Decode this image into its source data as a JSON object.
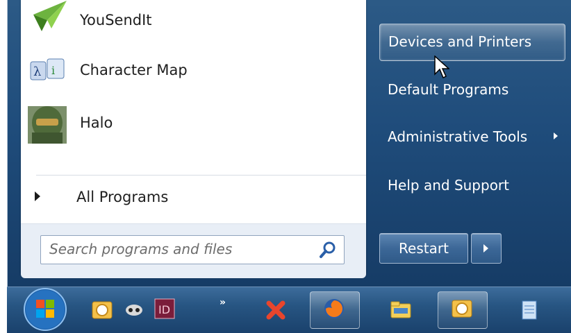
{
  "programs": [
    {
      "label": "YouSendIt",
      "icon": "yousendit-icon"
    },
    {
      "label": "Character Map",
      "icon": "character-map-icon"
    },
    {
      "label": "Halo",
      "icon": "halo-icon"
    }
  ],
  "all_programs_label": "All Programs",
  "search": {
    "placeholder": "Search programs and files"
  },
  "right_menu": [
    {
      "label": "Devices and Printers",
      "highlighted": true
    },
    {
      "label": "Default Programs"
    },
    {
      "label": "Administrative Tools",
      "has_submenu": true
    },
    {
      "label": "Help and Support"
    }
  ],
  "restart_label": "Restart",
  "taskbar": {
    "chevron": "»",
    "icons": [
      "outlook-icon",
      "alien-icon",
      "indesign-icon",
      "x-icon",
      "firefox-icon",
      "explorer-icon",
      "outlook-icon",
      "notepad-icon"
    ]
  },
  "colors": {
    "menu_blue": "#1f4c7b",
    "left_pane": "#ffffff"
  }
}
